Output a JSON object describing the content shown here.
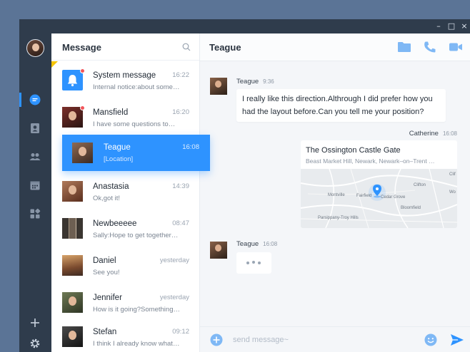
{
  "window": {
    "min": "–",
    "max": "□",
    "close": "×"
  },
  "colors": {
    "accent": "#2e93ff",
    "rail": "#2f3c4c",
    "badge": "#f2555a"
  },
  "rail": {
    "items": [
      {
        "icon": "chat-icon",
        "active": true
      },
      {
        "icon": "contacts-icon"
      },
      {
        "icon": "group-icon"
      },
      {
        "icon": "calendar-icon"
      },
      {
        "icon": "apps-icon"
      }
    ],
    "add_icon": "plus-icon",
    "settings_icon": "gear-icon"
  },
  "list": {
    "title": "Message",
    "search_icon": "search-icon",
    "conversations": [
      {
        "name": "System message",
        "time": "16:22",
        "preview": "Internal notice:about some…",
        "unread": true
      },
      {
        "name": "Mansfield",
        "time": "16:20",
        "preview": "I have some questions to…",
        "unread": true
      },
      {
        "name": "Teague",
        "time": "16:08",
        "preview": "[Location]",
        "selected": true
      },
      {
        "name": "Anastasia",
        "time": "14:39",
        "preview": "Ok,got it!"
      },
      {
        "name": "Newbeeeee",
        "time": "08:47",
        "preview": "Sally:Hope to get together…"
      },
      {
        "name": "Daniel",
        "time": "yesterday",
        "preview": "See you!"
      },
      {
        "name": "Jennifer",
        "time": "yesterday",
        "preview": "How is it going?Something…"
      },
      {
        "name": "Stefan",
        "time": "09:12",
        "preview": "I think I already know what…"
      }
    ]
  },
  "chat": {
    "title": "Teague",
    "header_icons": [
      "folder-icon",
      "phone-icon",
      "video-icon"
    ],
    "messages": [
      {
        "sender": "Teague",
        "time": "9:36",
        "text": "I really like this direction.Althrough I did prefer how you had the layout before.Can you tell me your position?"
      },
      {
        "sender": "Catherine",
        "time": "16:08",
        "location_title": "The Ossington Castle Gate",
        "location_address": "Beast Market Hill, Newark, Newark–on–Trent …"
      },
      {
        "sender": "Teague",
        "time": "16:08"
      }
    ],
    "map_labels": [
      "Clifton",
      "Fairfield",
      "Cedar Grove",
      "Montville",
      "Bloomfield",
      "Parsippany-Troy Hills",
      "Clif",
      "Wo"
    ],
    "input_placeholder": "send message~"
  }
}
